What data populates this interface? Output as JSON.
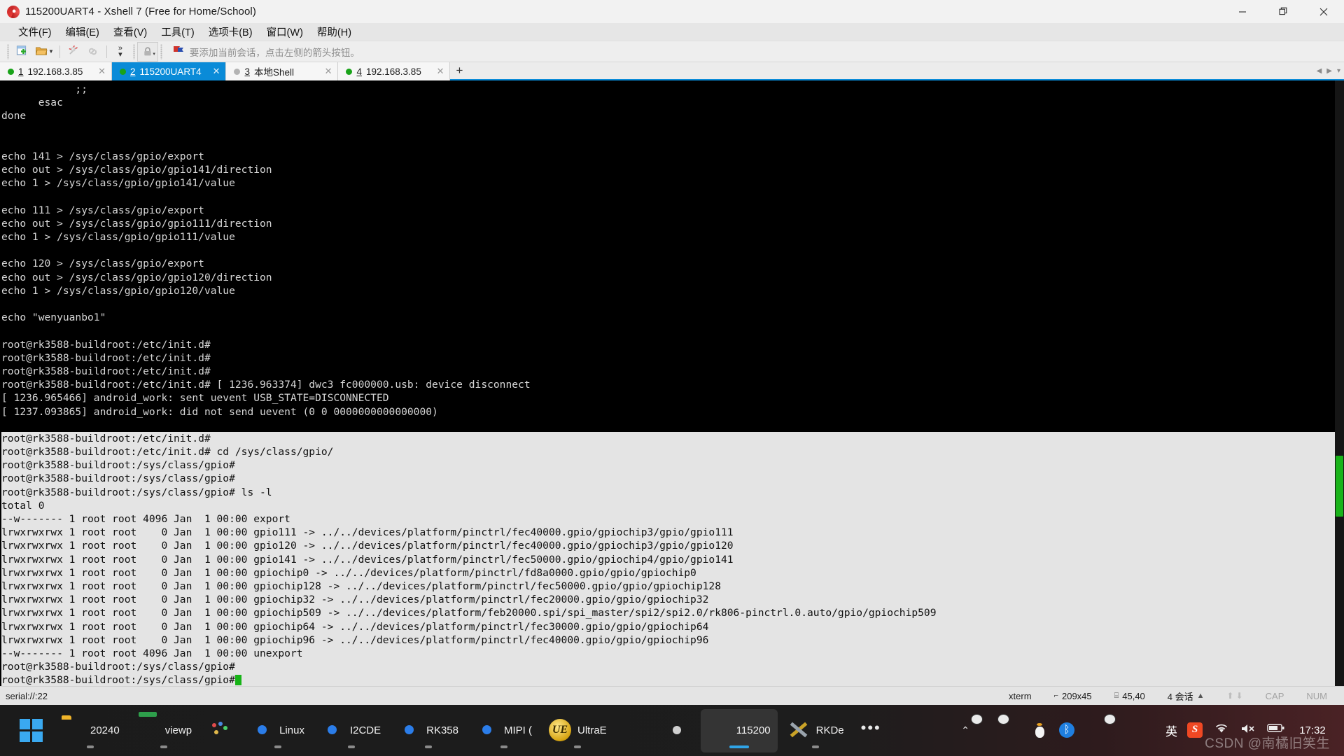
{
  "window": {
    "title": "115200UART4 - Xshell 7 (Free for Home/School)",
    "app_icon": "xshell-spiral-icon",
    "controls": {
      "minimize": "minimize-icon",
      "maximize": "restore-icon",
      "close": "close-icon"
    }
  },
  "menubar": [
    {
      "label": "文件(F)",
      "name": "menu-file"
    },
    {
      "label": "编辑(E)",
      "name": "menu-edit"
    },
    {
      "label": "查看(V)",
      "name": "menu-view"
    },
    {
      "label": "工具(T)",
      "name": "menu-tools"
    },
    {
      "label": "选项卡(B)",
      "name": "menu-tabs"
    },
    {
      "label": "窗口(W)",
      "name": "menu-window"
    },
    {
      "label": "帮助(H)",
      "name": "menu-help"
    }
  ],
  "toolbar": {
    "hint": "要添加当前会话，点击左侧的箭头按钮。",
    "buttons": [
      {
        "name": "new-session-button",
        "icon": "new-file-plus-icon"
      },
      {
        "name": "open-session-button",
        "icon": "folder-open-icon"
      },
      {
        "name": "open-session-dropdown",
        "icon": "caret-down-icon"
      },
      {
        "name": "disconnect-button",
        "icon": "broken-link-icon"
      },
      {
        "name": "reconnect-button",
        "icon": "link-icon"
      },
      {
        "name": "overflow-button",
        "icon": "chevron-double-icon"
      },
      {
        "name": "lock-button",
        "icon": "lock-icon"
      }
    ]
  },
  "tabs": [
    {
      "index": "1",
      "label": "192.168.3.85",
      "status": "connected",
      "active": false
    },
    {
      "index": "2",
      "label": "115200UART4",
      "status": "connected",
      "active": true
    },
    {
      "index": "3",
      "label": "本地Shell",
      "status": "disconnected",
      "active": false
    },
    {
      "index": "4",
      "label": "192.168.3.85",
      "status": "connected",
      "active": false
    }
  ],
  "tab_add_label": "+",
  "terminal": {
    "lines_top": [
      "            ;;",
      "      esac",
      "done",
      "",
      "",
      "echo 141 > /sys/class/gpio/export",
      "echo out > /sys/class/gpio/gpio141/direction",
      "echo 1 > /sys/class/gpio/gpio141/value",
      "",
      "echo 111 > /sys/class/gpio/export",
      "echo out > /sys/class/gpio/gpio111/direction",
      "echo 1 > /sys/class/gpio/gpio111/value",
      "",
      "echo 120 > /sys/class/gpio/export",
      "echo out > /sys/class/gpio/gpio120/direction",
      "echo 1 > /sys/class/gpio/gpio120/value",
      "",
      "echo \"wenyuanbo1\"",
      "",
      "root@rk3588-buildroot:/etc/init.d#",
      "root@rk3588-buildroot:/etc/init.d#",
      "root@rk3588-buildroot:/etc/init.d#",
      "root@rk3588-buildroot:/etc/init.d# [ 1236.963374] dwc3 fc000000.usb: device disconnect",
      "[ 1236.965466] android_work: sent uevent USB_STATE=DISCONNECTED",
      "[ 1237.093865] android_work: did not send uevent (0 0 0000000000000000)",
      ""
    ],
    "lines_selected": [
      "root@rk3588-buildroot:/etc/init.d#",
      "root@rk3588-buildroot:/etc/init.d# cd /sys/class/gpio/",
      "root@rk3588-buildroot:/sys/class/gpio#",
      "root@rk3588-buildroot:/sys/class/gpio#",
      "root@rk3588-buildroot:/sys/class/gpio# ls -l",
      "total 0",
      "--w------- 1 root root 4096 Jan  1 00:00 export",
      "lrwxrwxrwx 1 root root    0 Jan  1 00:00 gpio111 -> ../../devices/platform/pinctrl/fec40000.gpio/gpiochip3/gpio/gpio111",
      "lrwxrwxrwx 1 root root    0 Jan  1 00:00 gpio120 -> ../../devices/platform/pinctrl/fec40000.gpio/gpiochip3/gpio/gpio120",
      "lrwxrwxrwx 1 root root    0 Jan  1 00:00 gpio141 -> ../../devices/platform/pinctrl/fec50000.gpio/gpiochip4/gpio/gpio141",
      "lrwxrwxrwx 1 root root    0 Jan  1 00:00 gpiochip0 -> ../../devices/platform/pinctrl/fd8a0000.gpio/gpio/gpiochip0",
      "lrwxrwxrwx 1 root root    0 Jan  1 00:00 gpiochip128 -> ../../devices/platform/pinctrl/fec50000.gpio/gpio/gpiochip128",
      "lrwxrwxrwx 1 root root    0 Jan  1 00:00 gpiochip32 -> ../../devices/platform/pinctrl/fec20000.gpio/gpio/gpiochip32",
      "lrwxrwxrwx 1 root root    0 Jan  1 00:00 gpiochip509 -> ../../devices/platform/feb20000.spi/spi_master/spi2/spi2.0/rk806-pinctrl.0.auto/gpio/gpiochip509",
      "lrwxrwxrwx 1 root root    0 Jan  1 00:00 gpiochip64 -> ../../devices/platform/pinctrl/fec30000.gpio/gpio/gpiochip64",
      "lrwxrwxrwx 1 root root    0 Jan  1 00:00 gpiochip96 -> ../../devices/platform/pinctrl/fec40000.gpio/gpio/gpiochip96",
      "--w------- 1 root root 4096 Jan  1 00:00 unexport",
      "root@rk3588-buildroot:/sys/class/gpio#"
    ],
    "prompt_line": "root@rk3588-buildroot:/sys/class/gpio#",
    "cursor": "block-cursor",
    "colors": {
      "background": "#000000",
      "foreground": "#d6d6d6",
      "selection_bg": "#e4e4e4",
      "cursor": "#17b317"
    }
  },
  "statusbar": {
    "left": "serial://:22",
    "terminal_type": "xterm",
    "size": "209x45",
    "cursor_pos": "45,40",
    "sessions": "4 会话",
    "caps": "CAP",
    "num": "NUM"
  },
  "taskbar": {
    "apps": [
      {
        "label": "",
        "icon": "windows-start-icon",
        "name": "start-button",
        "running": false,
        "active": false
      },
      {
        "label": "20240",
        "icon": "folder-icon",
        "name": "taskbar-explorer",
        "running": true,
        "active": false
      },
      {
        "label": "viewp",
        "icon": "virtualbox-icon",
        "name": "taskbar-viewp",
        "running": true,
        "active": false
      },
      {
        "label": "",
        "icon": "paint-palette-icon",
        "name": "taskbar-paint",
        "running": false,
        "active": false
      },
      {
        "label": "Linux",
        "icon": "chrome-icon",
        "name": "taskbar-linux",
        "running": true,
        "active": false
      },
      {
        "label": "I2CDE",
        "icon": "chrome-icon",
        "name": "taskbar-i2cde",
        "running": true,
        "active": false
      },
      {
        "label": "RK358",
        "icon": "chrome-icon",
        "name": "taskbar-rk358",
        "running": true,
        "active": false
      },
      {
        "label": "MIPI (",
        "icon": "chrome-icon",
        "name": "taskbar-mipi",
        "running": true,
        "active": false
      },
      {
        "label": "UltraE",
        "icon": "ultraedit-icon",
        "name": "taskbar-ultraedit",
        "running": true,
        "active": false
      },
      {
        "label": "",
        "icon": "notepad-icon",
        "name": "taskbar-notepad",
        "running": false,
        "active": false
      },
      {
        "label": "",
        "icon": "disk-tool-icon",
        "name": "taskbar-disktool",
        "running": false,
        "active": false
      },
      {
        "label": "115200",
        "icon": "xshell-icon",
        "name": "taskbar-xshell",
        "running": true,
        "active": true
      },
      {
        "label": "RKDe",
        "icon": "rkdevtool-icon",
        "name": "taskbar-rkdevtool",
        "running": true,
        "active": false
      },
      {
        "label": "",
        "icon": "overflow-dots-icon",
        "name": "taskbar-overflow",
        "running": false,
        "active": false
      }
    ],
    "tray": [
      {
        "icon": "chevron-up-icon",
        "name": "tray-show-hidden"
      },
      {
        "icon": "wechat-icon",
        "name": "tray-wechat-1"
      },
      {
        "icon": "wechat-icon",
        "name": "tray-wechat-2"
      },
      {
        "icon": "qq-penguin-icon",
        "name": "tray-qq"
      },
      {
        "icon": "bluetooth-icon",
        "name": "tray-bluetooth"
      },
      {
        "icon": "shield-warning-icon",
        "name": "tray-security"
      },
      {
        "icon": "wechat-icon",
        "name": "tray-wechat-3"
      },
      {
        "icon": "notebook-icon",
        "name": "tray-notebook"
      },
      {
        "icon": "ime-chinese-icon",
        "name": "tray-ime",
        "label": "英"
      },
      {
        "icon": "sogou-icon",
        "name": "tray-sogou"
      },
      {
        "icon": "wifi-icon",
        "name": "tray-network"
      },
      {
        "icon": "volume-muted-icon",
        "name": "tray-volume"
      },
      {
        "icon": "battery-icon",
        "name": "tray-battery"
      }
    ],
    "clock": "17:32",
    "watermark": "CSDN @南橘旧笑生"
  }
}
